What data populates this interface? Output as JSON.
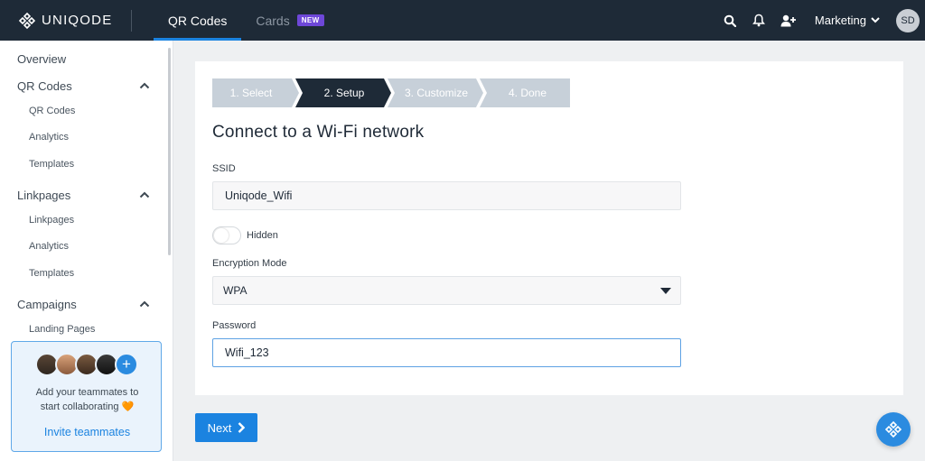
{
  "brand": {
    "name": "UNIQODE",
    "icon": "uniqode-logo-icon"
  },
  "topnav": {
    "tabs": [
      {
        "label": "QR Codes",
        "active": true
      },
      {
        "label": "Cards",
        "badge": "NEW"
      }
    ],
    "icons": [
      "search-icon",
      "bell-icon",
      "add-user-icon"
    ],
    "workspace": "Marketing",
    "user_initials": "SD"
  },
  "sidebar": {
    "overview": "Overview",
    "sections": [
      {
        "label": "QR Codes",
        "items": [
          "QR Codes",
          "Analytics",
          "Templates"
        ]
      },
      {
        "label": "Linkpages",
        "items": [
          "Linkpages",
          "Analytics",
          "Templates"
        ]
      },
      {
        "label": "Campaigns",
        "items": [
          "Landing Pages"
        ]
      }
    ],
    "invite": {
      "text": "Add your teammates to start collaborating 🧡",
      "link": "Invite teammates"
    }
  },
  "stepper": {
    "steps": [
      {
        "label": "1. Select",
        "state": "done"
      },
      {
        "label": "2. Setup",
        "state": "active"
      },
      {
        "label": "3. Customize",
        "state": "pending"
      },
      {
        "label": "4. Done",
        "state": "pending"
      }
    ]
  },
  "form": {
    "heading": "Connect to a Wi-Fi network",
    "ssid_label": "SSID",
    "ssid_value": "Uniqode_Wifi",
    "hidden_label": "Hidden",
    "hidden_on": false,
    "encryption_label": "Encryption Mode",
    "encryption_value": "WPA",
    "password_label": "Password",
    "password_value": "Wifi_123"
  },
  "actions": {
    "next_label": "Next"
  },
  "colors": {
    "topbar": "#1e2a37",
    "accent": "#1b83e0",
    "step_active": "#1e2a37",
    "step_inactive": "#c7d0d9",
    "badge_new": "#6e47d8"
  }
}
